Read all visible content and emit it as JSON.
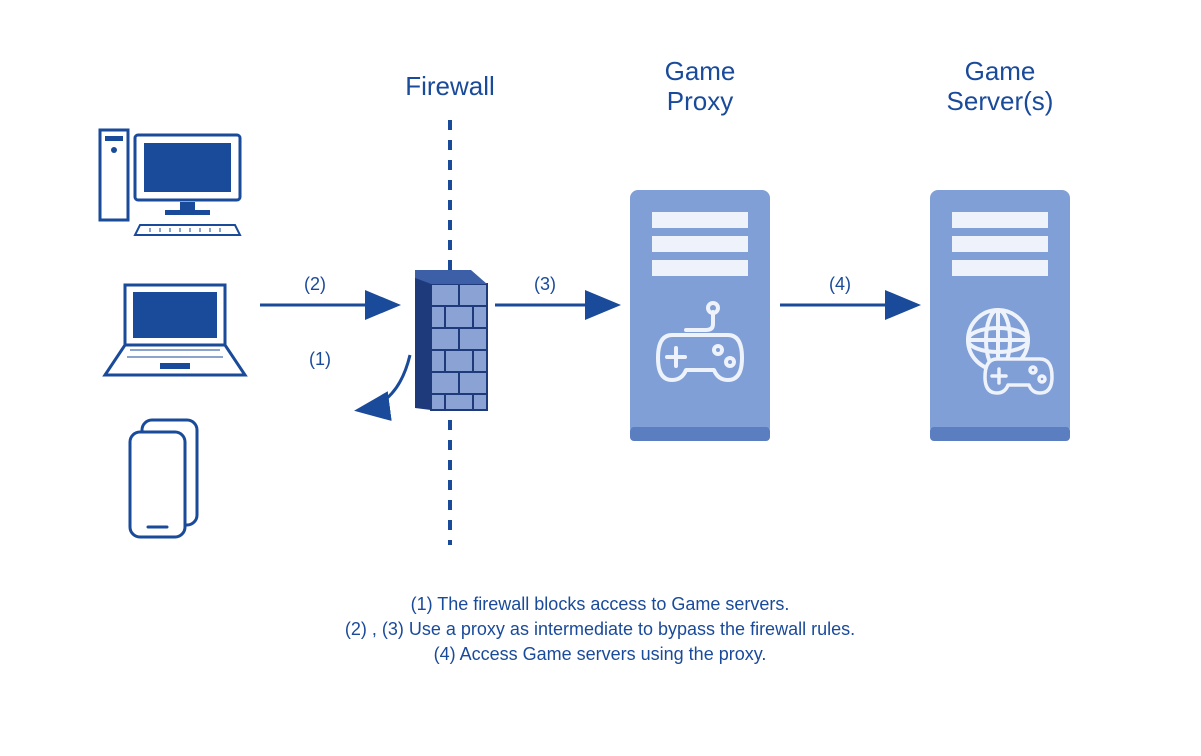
{
  "titles": {
    "firewall": "Firewall",
    "proxy_line1": "Game",
    "proxy_line2": "Proxy",
    "server_line1": "Game",
    "server_line2": "Server(s)"
  },
  "steps": {
    "s1": "(1)",
    "s2": "(2)",
    "s3": "(3)",
    "s4": "(4)"
  },
  "legend": {
    "l1": "(1) The firewall blocks access to Game servers.",
    "l2": "(2) , (3) Use a proxy as intermediate to bypass the firewall rules.",
    "l3": "(4) Access Game servers using the proxy."
  },
  "colors": {
    "primary": "#1a4a9a",
    "server_fill": "#809fd6",
    "server_light": "#c8d5ef",
    "firewall_dark": "#1f3a7a",
    "firewall_mid": "#3d5fa8",
    "firewall_light": "#8aa3d4"
  }
}
